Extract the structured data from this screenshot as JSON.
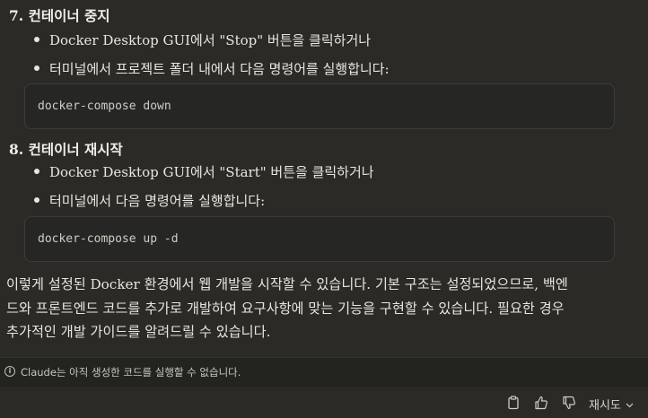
{
  "steps": [
    {
      "heading": "7. 컨테이너 중지",
      "bullets": [
        "Docker Desktop GUI에서 \"Stop\" 버튼을 클릭하거나",
        "터미널에서 프로젝트 폴더 내에서 다음 명령어를 실행합니다:"
      ],
      "code": "docker-compose down"
    },
    {
      "heading": "8. 컨테이너 재시작",
      "bullets": [
        "Docker Desktop GUI에서 \"Start\" 버튼을 클릭하거나",
        "터미널에서 다음 명령어를 실행합니다:"
      ],
      "code": "docker-compose up -d"
    }
  ],
  "summary_lines": [
    "이렇게 설정된 Docker 환경에서 웹 개발을 시작할 수 있습니다. 기본 구조는 설정되었으므로, 백엔",
    "드와 프론트엔드 코드를 추가로 개발하여 요구사항에 맞는 기능을 구현할 수 있습니다. 필요한 경우",
    "추가적인 개발 가이드를 알려드릴 수 있습니다."
  ],
  "notice": {
    "icon": "info-icon",
    "text": "Claude는 아직 생성한 코드를 실행할 수 없습니다."
  },
  "actions": {
    "copy_icon": "clipboard-icon",
    "thumbs_up_icon": "thumbs-up-icon",
    "thumbs_down_icon": "thumbs-down-icon",
    "retry_label": "재시도",
    "retry_icon": "chevron-down-icon"
  }
}
